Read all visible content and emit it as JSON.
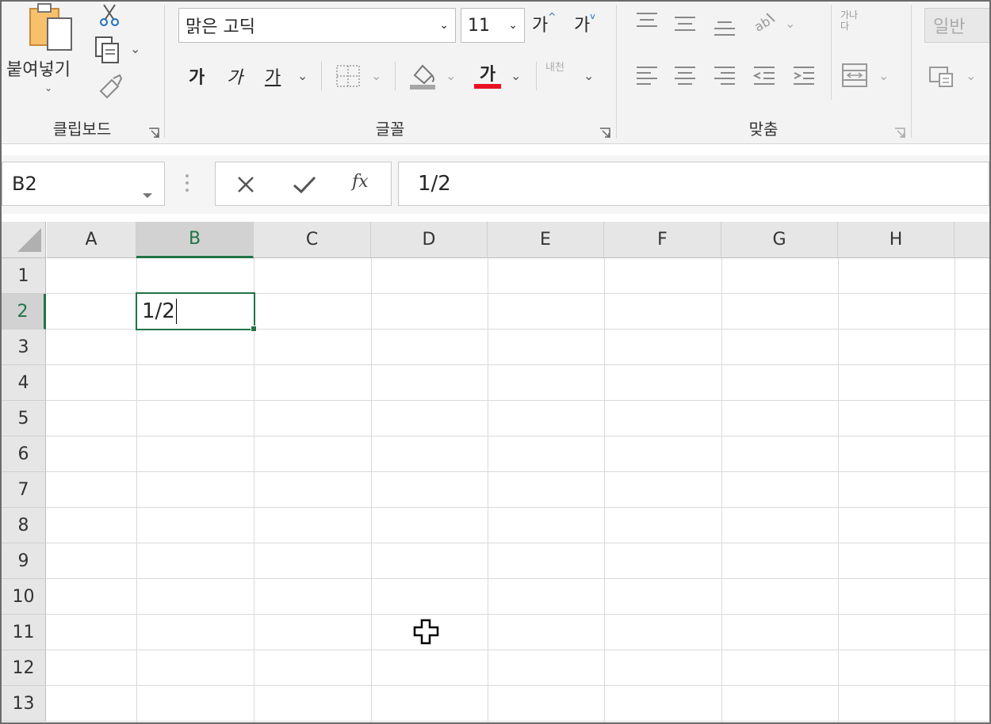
{
  "ribbon": {
    "clipboard": {
      "paste_label": "붙여넣기",
      "group_label": "클립보드"
    },
    "font": {
      "font_name": "맑은 고딕",
      "font_size": "11",
      "grow_label": "가",
      "shrink_label": "가",
      "bold_label": "가",
      "italic_label": "가",
      "underline_label": "가",
      "font_color_label": "가",
      "font_color": "#e81123",
      "phonetic_label": "내천",
      "group_label": "글꼴"
    },
    "alignment": {
      "wrap_label": "가나다",
      "group_label": "맞춤"
    },
    "number": {
      "format": "일반"
    }
  },
  "formula_bar": {
    "name_box": "B2",
    "fx_label": "fx",
    "value": "1/2"
  },
  "grid": {
    "columns": [
      "A",
      "B",
      "C",
      "D",
      "E",
      "F",
      "G",
      "H"
    ],
    "rows": [
      "1",
      "2",
      "3",
      "4",
      "5",
      "6",
      "7",
      "8",
      "9",
      "10",
      "11",
      "12",
      "13"
    ],
    "selected_column": "B",
    "selected_row": "2",
    "active_cell_value": "1/2"
  },
  "colors": {
    "accent": "#217346",
    "ribbon_bg": "#f3f3f3",
    "header_bg": "#e6e6e6"
  }
}
